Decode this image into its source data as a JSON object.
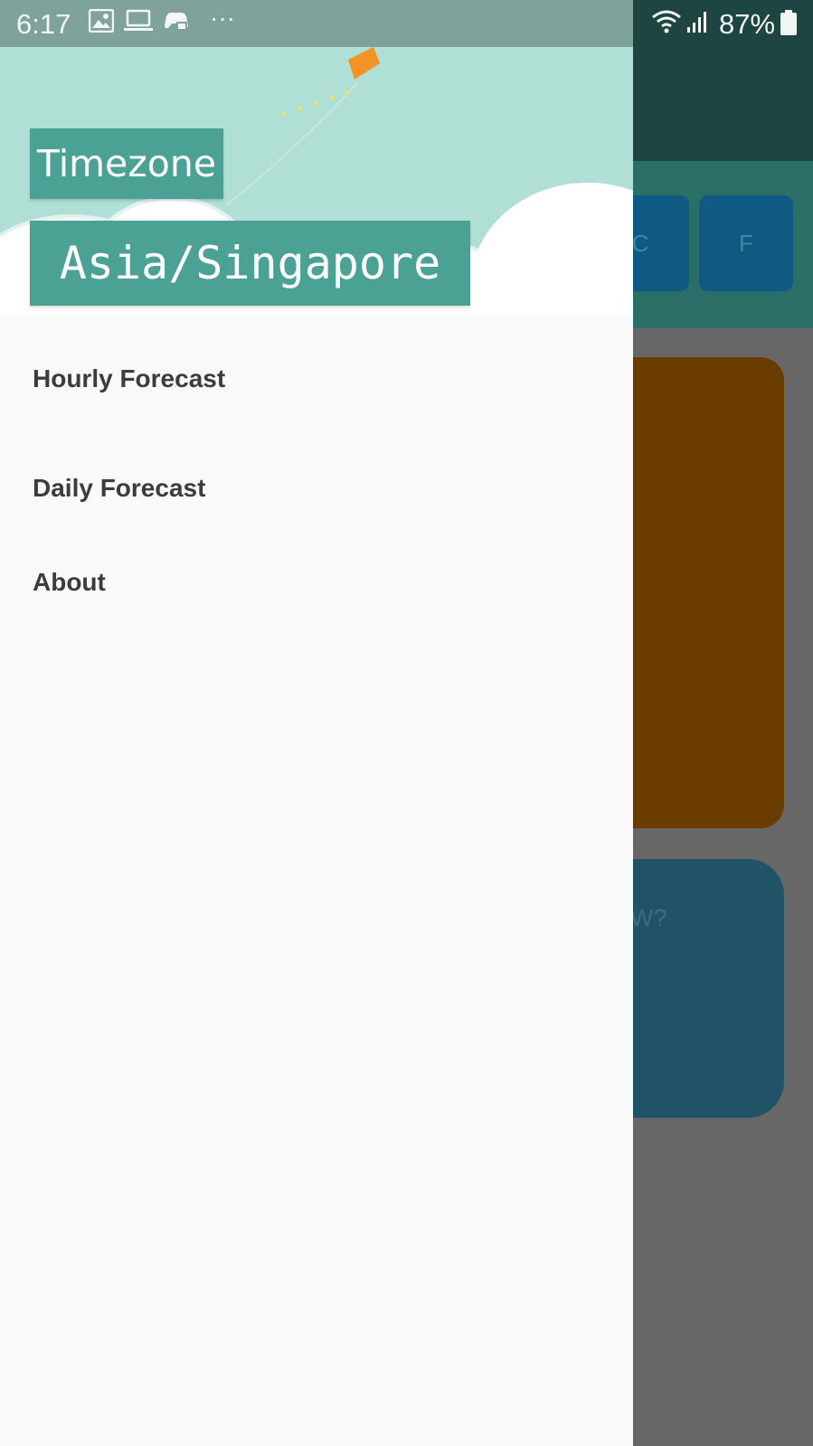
{
  "status_bar": {
    "time": "6:17",
    "battery": "87%",
    "icons": [
      "image-icon",
      "laptop-icon",
      "game-controller-icon",
      "more-dots-icon",
      "wifi-icon",
      "signal-icon",
      "battery-icon"
    ]
  },
  "drawer": {
    "header": {
      "timezone_label": "Timezone",
      "timezone_value": "Asia/Singapore"
    },
    "menu": [
      {
        "label": "Hourly Forecast"
      },
      {
        "label": "Daily Forecast"
      },
      {
        "label": "About"
      }
    ]
  },
  "background_app": {
    "units": [
      "C",
      "F"
    ],
    "card_partial_text": "W?"
  },
  "colors": {
    "header_bg": "#b0dfd6",
    "label_bg": "#4ba194",
    "kite": "#f39323",
    "drawer_bg": "#f9f9f9"
  }
}
